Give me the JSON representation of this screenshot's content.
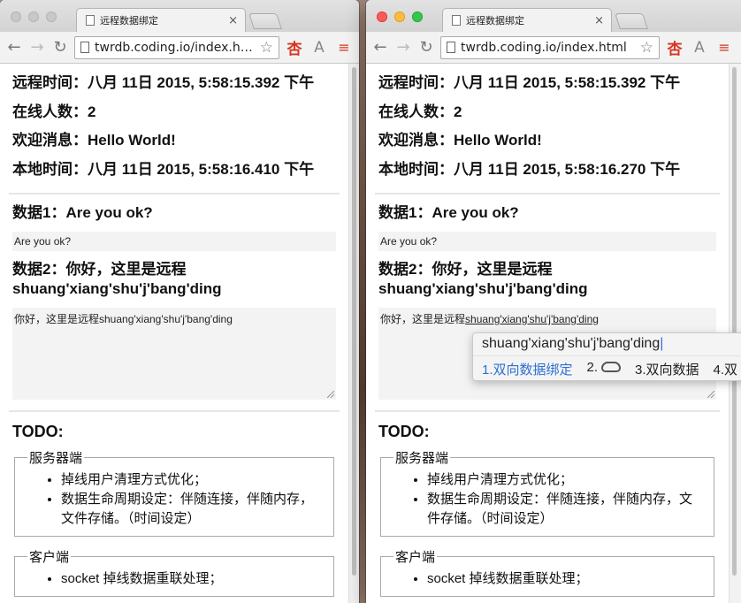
{
  "left": {
    "tab_title": "远程数据绑定",
    "url": "twrdb.coding.io/index.html",
    "remote_time_label": "远程时间：",
    "remote_time": "八月 11日 2015, 5:58:15.392 下午",
    "online_label": "在线人数：",
    "online": "2",
    "welcome_label": "欢迎消息：",
    "welcome": "Hello World!",
    "local_time_label": "本地时间：",
    "local_time": "八月 11日 2015, 5:58:16.410 下午",
    "data1_heading": "数据1：Are you ok?",
    "data1_value": "Are you ok?",
    "data2_heading": "数据2：你好，这里是远程shuang'xiang'shu'j'bang'ding",
    "data2_value": "你好，这里是远程shuang'xiang'shu'j'bang'ding",
    "todo_title": "TODO:",
    "server_legend": "服务器端",
    "server_items": [
      "掉线用户清理方式优化；",
      "数据生命周期设定：伴随连接，伴随内存，文件存储。（时间设定）"
    ],
    "client_legend": "客户端",
    "client_items": [
      "socket 掉线数据重联处理；"
    ]
  },
  "right": {
    "tab_title": "远程数据绑定",
    "url": "twrdb.coding.io/index.html",
    "remote_time_label": "远程时间：",
    "remote_time": "八月 11日 2015, 5:58:15.392 下午",
    "online_label": "在线人数：",
    "online": "2",
    "welcome_label": "欢迎消息：",
    "welcome": "Hello World!",
    "local_time_label": "本地时间：",
    "local_time": "八月 11日 2015, 5:58:16.270 下午",
    "data1_heading": "数据1：Are you ok?",
    "data1_value": "Are you ok?",
    "data2_heading": "数据2：你好，这里是远程shuang'xiang'shu'j'bang'ding",
    "data2_prefix": "你好，这里是远程",
    "data2_composing": "shuang'xiang'shu'j'bang'ding",
    "todo_title": "TODO:",
    "server_legend": "服务器端",
    "server_items": [
      "掉线用户清理方式优化；",
      "数据生命周期设定：伴随连接，伴随内存，文件存储。（时间设定）"
    ],
    "client_legend": "客户端",
    "client_items": [
      "socket 掉线数据重联处理；"
    ]
  },
  "ime": {
    "input": "shuang'xiang'shu'j'bang'ding",
    "candidates": [
      "1.双向数据绑定",
      "2.",
      "3.双向数据",
      "4.双"
    ]
  },
  "icons": {
    "back": "←",
    "forward": "→",
    "reload": "↻",
    "star": "☆",
    "ext1": "杏",
    "ext2": "A",
    "menu": "≡",
    "close": "×"
  }
}
